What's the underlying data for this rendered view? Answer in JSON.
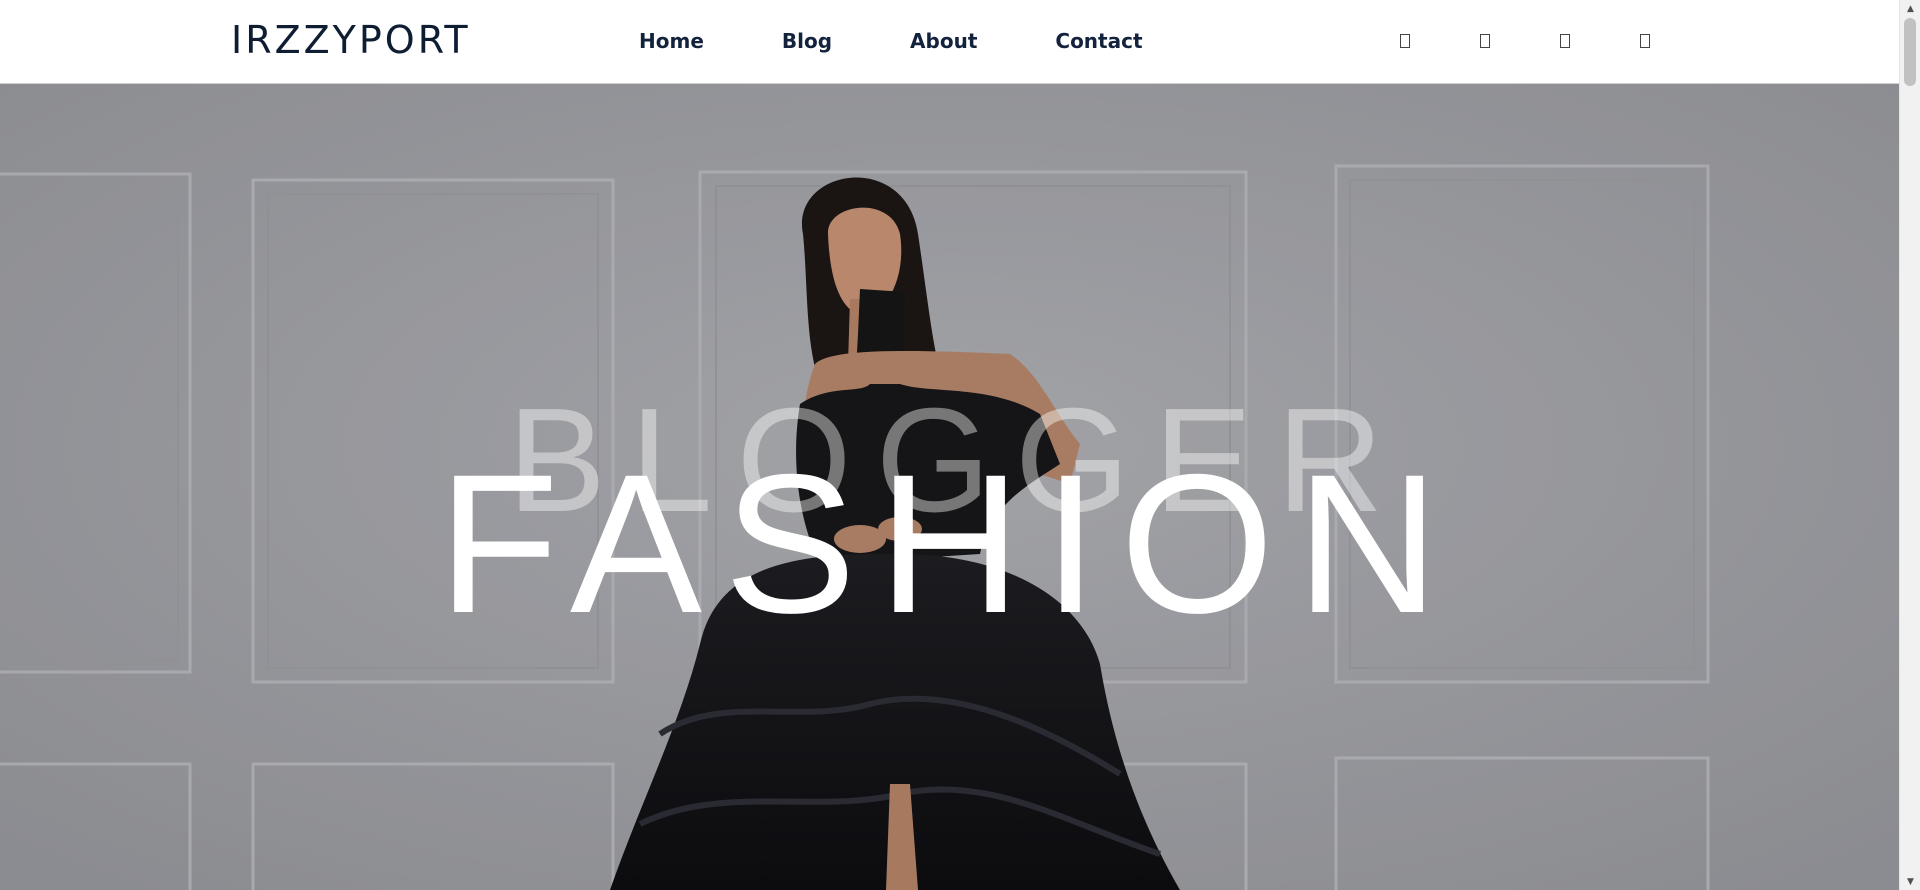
{
  "header": {
    "logo": "IRZZYPORT",
    "nav": [
      {
        "label": "Home"
      },
      {
        "label": "Blog"
      },
      {
        "label": "About"
      },
      {
        "label": "Contact"
      }
    ],
    "social_icons": [
      "social-icon-1",
      "social-icon-2",
      "social-icon-3",
      "social-icon-4"
    ]
  },
  "hero": {
    "subtitle": "BLOGGER",
    "title": "FASHION",
    "image_subject": "woman in black gown against grey paneled wall"
  },
  "colors": {
    "logo": "#0f1d33",
    "nav_text": "#14233d",
    "hero_overlay": "#9d9ea2",
    "hero_title": "#ffffff"
  }
}
